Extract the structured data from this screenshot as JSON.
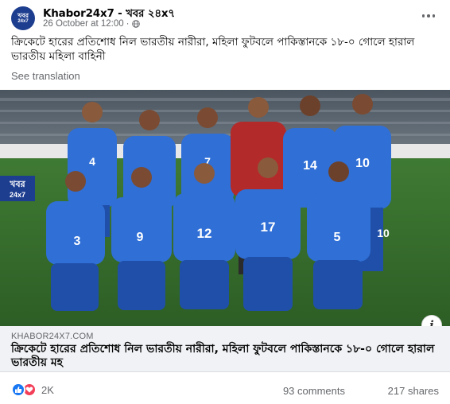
{
  "post": {
    "page_name": "Khabor24x7 - খবর ২৪x৭",
    "avatar_text_top": "খবর",
    "avatar_text_bottom": "24x7",
    "timestamp": "26 October at 12:00",
    "separator": "·",
    "text": "ক্রিকেটে হারের প্রতিশোধ নিল ভারতীয় নারীরা, মহিলা ফুটবলে পাকিস্তানকে ১৮-০ গোলে হারাল ভারতীয় মহিলা বাহিনী",
    "see_translation": "See translation"
  },
  "image": {
    "watermark_top": "খবর",
    "watermark_bottom": "24x7",
    "jersey_numbers_back": [
      "4",
      "",
      "7",
      "",
      "14",
      "10"
    ],
    "jersey_numbers_front": [
      "3",
      "9",
      "12",
      "17",
      "5",
      "10"
    ]
  },
  "link_preview": {
    "domain": "KHABOR24X7.COM",
    "title": "ক্রিকেটে হারের প্রতিশোধ নিল ভারতীয় নারীরা, মহিলা ফুটবলে পাকিস্তানকে ১৮-০ গোলে হারাল ভারতীয় মহ"
  },
  "engagement": {
    "reaction_count": "2K",
    "comments": "93 comments",
    "shares": "217 shares"
  },
  "colors": {
    "facebook_blue": "#1877f2",
    "love_red": "#f33e58",
    "jersey_blue": "#2f6fd6",
    "goalkeeper_red": "#b32a2a"
  },
  "icons": [
    "more-icon",
    "globe-icon",
    "info-icon",
    "like-icon",
    "love-icon"
  ]
}
